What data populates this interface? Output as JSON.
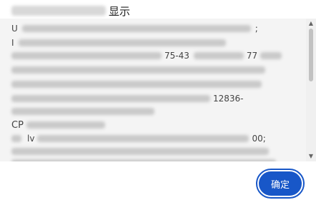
{
  "dialog": {
    "title": "显示",
    "content_lines": [
      {
        "prefix": "U",
        "suffix": ";"
      },
      {
        "prefix": "I",
        "suffix": ""
      },
      {
        "prefix": "",
        "suffix": "75-43"
      },
      {
        "prefix": "",
        "suffix": "77"
      },
      {
        "prefix": "",
        "suffix": ""
      },
      {
        "prefix": "",
        "suffix": "12836-"
      },
      {
        "prefix": "",
        "suffix": ""
      },
      {
        "prefix": "CP",
        "suffix": ""
      },
      {
        "prefix": "lv",
        "suffix": "00;"
      },
      {
        "prefix": "",
        "suffix": ""
      },
      {
        "prefix": "",
        "suffix": ""
      }
    ],
    "ok_label": "确定"
  },
  "colors": {
    "accent": "#1857c8",
    "content_bg": "#f4f4f4"
  },
  "icons": {
    "scroll_up": "chevron-up-icon",
    "scroll_down": "chevron-down-icon"
  }
}
